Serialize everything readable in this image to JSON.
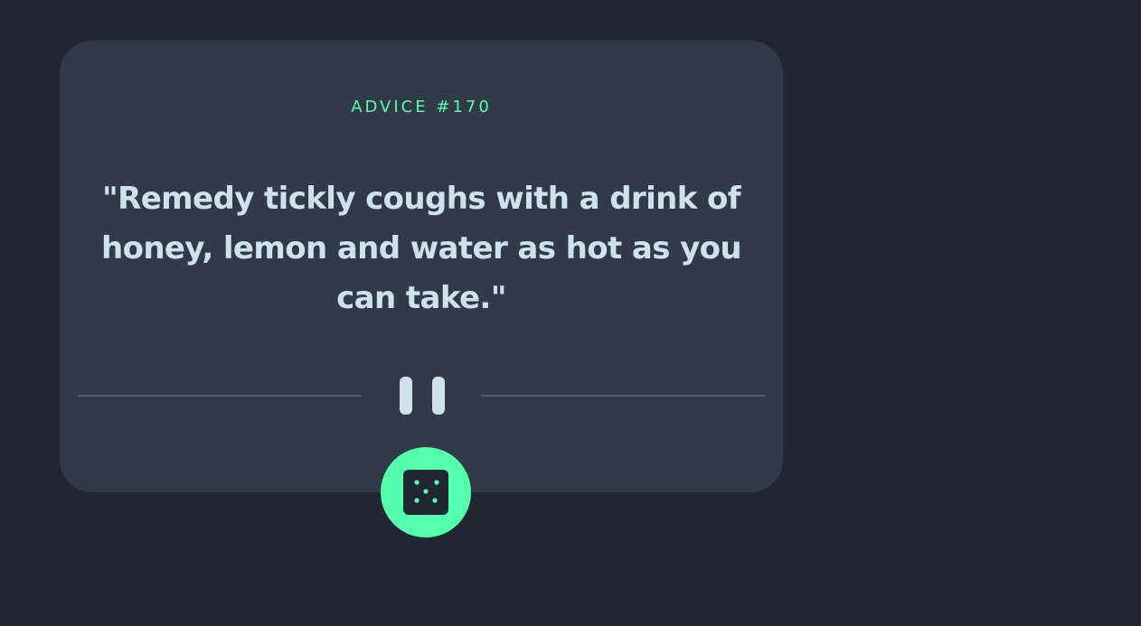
{
  "advice": {
    "id_label": "ADVICE #170",
    "text": "\"Remedy tickly coughs with a drink of honey, lemon and water as hot as you can take.\""
  },
  "divider": {
    "icon": "pause-icon"
  },
  "generate_button": {
    "icon": "dice-icon"
  },
  "colors": {
    "background": "#202632",
    "card": "#323a49",
    "accent": "#53ffaa",
    "text": "#cee3e9",
    "divider": "#4f5d74"
  }
}
